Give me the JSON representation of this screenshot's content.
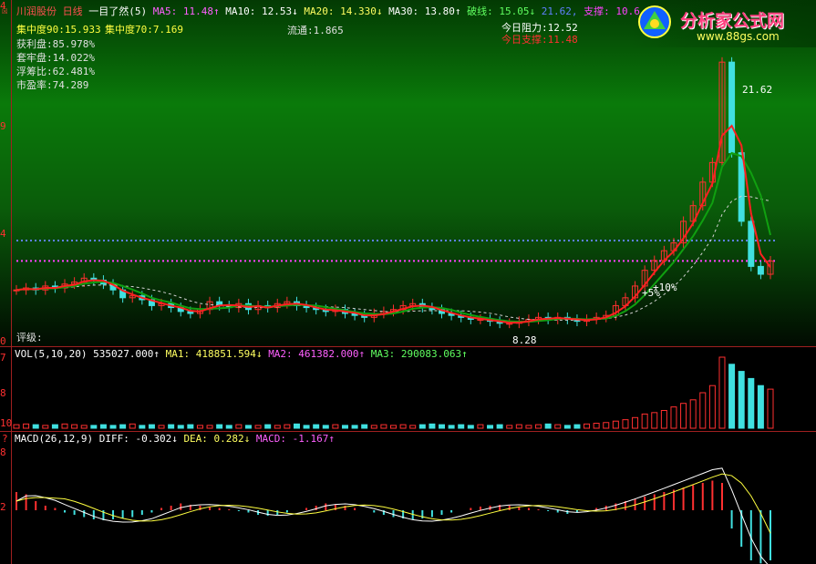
{
  "header": {
    "stock_name": "川润股份",
    "period": "日线",
    "indicator": "一目了然(5)",
    "ma5": "MA5: 11.48↑",
    "ma10": "MA10: 12.53↓",
    "ma20": "MA20: 14.330↓",
    "ma30": "MA30: 13.80↑",
    "break_line": "破线: 15.05↓",
    "break_value": "21.62,",
    "support_label": "支撑: 10.6"
  },
  "stats": {
    "conc90": "集中度90:15.933",
    "conc70": "集中度70:7.169",
    "profit": "获利盘:85.978%",
    "trapped": "套牢盘:14.022%",
    "float_ratio": "浮筹比:62.481%",
    "pe": "市盈率:74.289",
    "circulation": "流通:1.865",
    "resistance": "今日阻力:12.52",
    "support": "今日支撑:11.48",
    "rating": "评级:"
  },
  "annotations": {
    "high": "21.62",
    "low": "8.28",
    "pct10": "+10%",
    "pct5": "+5%"
  },
  "axis": {
    "main_ticks": [
      "4",
      "9",
      "4",
      "0"
    ],
    "vol_ticks": [
      "7",
      "8",
      "10"
    ],
    "macd_ticks": [
      "8",
      "2"
    ]
  },
  "vol_header": {
    "label": "VOL(5,10,20)",
    "value": "535027.000↑",
    "ma1": "MA1: 418851.594↓",
    "ma2": "MA2: 461382.000↑",
    "ma3": "MA3: 290083.063↑"
  },
  "macd_header": {
    "label": "MACD(26,12,9)",
    "diff": "DIFF: -0.302↓",
    "dea": "DEA: 0.282↓",
    "macd": "MACD: -1.167↑"
  },
  "logo": {
    "title": "分析家公式网",
    "url": "www.88gs.com"
  },
  "colors": {
    "up": "#ff3030",
    "down": "#40e0e0",
    "ma5": "#ff2020",
    "ma10": "#10a010",
    "ma30": "#d0d0d0",
    "magenta": "#ff40ff",
    "blue": "#6080ff",
    "yellow": "#ffff40"
  },
  "chart_data": [
    {
      "type": "candlestick",
      "price_range": [
        7.5,
        22
      ],
      "close": [
        10.0,
        10.1,
        10.0,
        10.2,
        10.1,
        10.3,
        10.4,
        10.6,
        10.5,
        10.3,
        10.0,
        9.6,
        9.7,
        9.5,
        9.2,
        9.3,
        9.1,
        8.9,
        8.8,
        9.0,
        9.4,
        9.2,
        9.1,
        9.3,
        9.0,
        9.2,
        9.1,
        9.3,
        9.4,
        9.2,
        9.1,
        9.0,
        8.9,
        9.0,
        8.8,
        8.7,
        8.6,
        8.8,
        8.9,
        9.0,
        9.2,
        9.3,
        9.1,
        9.0,
        8.8,
        8.7,
        8.6,
        8.5,
        8.5,
        8.4,
        8.3,
        8.3,
        8.4,
        8.5,
        8.6,
        8.5,
        8.6,
        8.5,
        8.4,
        8.5,
        8.6,
        8.7,
        9.2,
        9.6,
        10.2,
        11.0,
        11.5,
        12.0,
        12.4,
        13.5,
        14.3,
        15.5,
        16.5,
        21.62,
        17.0,
        13.5,
        11.2,
        10.8,
        11.48
      ],
      "ma_lines": [
        "MA5",
        "MA10",
        "MA30"
      ],
      "resistance": 12.52,
      "support": 11.48,
      "high_label": 21.62,
      "low_label": 8.28
    },
    {
      "type": "bar",
      "name": "VOL(5,10,20)",
      "values": [
        0.05,
        0.06,
        0.05,
        0.04,
        0.05,
        0.06,
        0.05,
        0.04,
        0.04,
        0.05,
        0.04,
        0.05,
        0.06,
        0.04,
        0.05,
        0.04,
        0.05,
        0.04,
        0.05,
        0.04,
        0.04,
        0.05,
        0.04,
        0.05,
        0.04,
        0.04,
        0.05,
        0.04,
        0.05,
        0.06,
        0.04,
        0.05,
        0.04,
        0.05,
        0.04,
        0.04,
        0.05,
        0.04,
        0.05,
        0.04,
        0.05,
        0.04,
        0.05,
        0.06,
        0.05,
        0.04,
        0.05,
        0.04,
        0.05,
        0.04,
        0.05,
        0.04,
        0.05,
        0.04,
        0.05,
        0.06,
        0.05,
        0.04,
        0.05,
        0.06,
        0.07,
        0.08,
        0.1,
        0.12,
        0.15,
        0.2,
        0.22,
        0.25,
        0.3,
        0.35,
        0.4,
        0.5,
        0.6,
        1.0,
        0.9,
        0.8,
        0.7,
        0.6,
        0.55
      ]
    },
    {
      "type": "bar",
      "name": "MACD(26,12,9)",
      "values": [
        0.4,
        0.35,
        0.2,
        0.1,
        0.05,
        -0.05,
        -0.1,
        -0.15,
        -0.2,
        -0.22,
        -0.2,
        -0.18,
        -0.15,
        -0.1,
        -0.05,
        0.05,
        0.1,
        0.15,
        0.12,
        0.1,
        0.08,
        0.05,
        0.02,
        -0.02,
        -0.05,
        -0.1,
        -0.12,
        -0.1,
        -0.05,
        0.0,
        0.05,
        0.1,
        0.15,
        0.12,
        0.1,
        0.05,
        0.0,
        -0.05,
        -0.1,
        -0.15,
        -0.18,
        -0.2,
        -0.18,
        -0.15,
        -0.1,
        -0.05,
        0.0,
        0.05,
        0.08,
        0.1,
        0.12,
        0.1,
        0.08,
        0.05,
        0.02,
        -0.02,
        -0.05,
        -0.08,
        -0.05,
        0.0,
        0.05,
        0.1,
        0.15,
        0.2,
        0.25,
        0.3,
        0.35,
        0.4,
        0.45,
        0.5,
        0.55,
        0.6,
        0.65,
        0.6,
        -0.4,
        -0.8,
        -1.1,
        -1.167,
        -1.1
      ]
    }
  ]
}
